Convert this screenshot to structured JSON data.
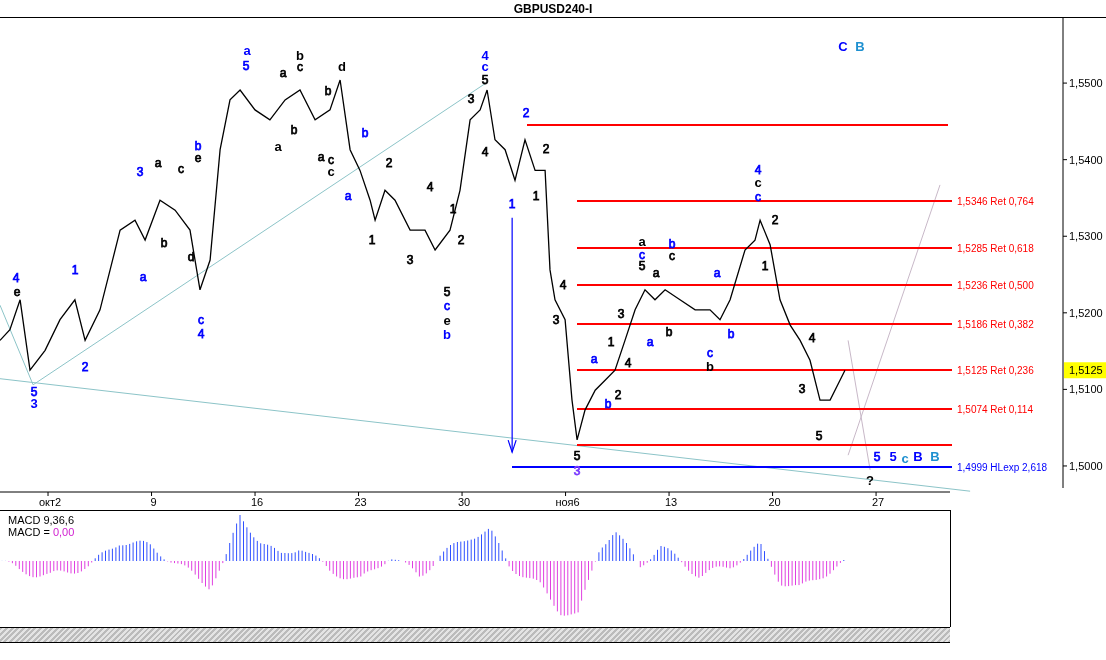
{
  "window": {
    "title": "GBPUSD240-I"
  },
  "main_chart": {
    "date_axis_labels": [
      "окт2",
      "9",
      "16",
      "23",
      "30",
      "ноя6",
      "13",
      "20",
      "27"
    ],
    "price_axis_labels": [
      "1,5500",
      "1,5400",
      "1,5300",
      "1,5200",
      "1,5100",
      "1,5000"
    ],
    "current_price": "1,5125",
    "levels": [
      {
        "color": "#ff0000"
      },
      {
        "color": "#ff0000",
        "label": "1,5346 Ret 0,764"
      },
      {
        "color": "#ff0000",
        "label": "1,5285 Ret 0,618"
      },
      {
        "color": "#ff0000",
        "label": "1,5236 Ret 0,500"
      },
      {
        "color": "#ff0000",
        "label": "1,5186 Ret 0,382"
      },
      {
        "color": "#ff0000",
        "label": "1,5125 Ret 0,236"
      },
      {
        "color": "#ff0000",
        "label": "1,5074 Ret 0,114"
      },
      {
        "color": "#ff0000"
      },
      {
        "color": "#0000ff",
        "label": "1,4999 HLexp 2,618"
      }
    ],
    "wave_labels": [
      {
        "text": "4",
        "color": "#0000ff",
        "bold": false
      },
      {
        "text": "e",
        "color": "#000000",
        "bold": false
      },
      {
        "text": "5",
        "color": "#0000ff",
        "bold": false
      },
      {
        "text": "3",
        "color": "#0000ff",
        "bold": true
      },
      {
        "text": "1",
        "color": "#0000ff",
        "bold": false
      },
      {
        "text": "2",
        "color": "#0000ff",
        "bold": false
      },
      {
        "text": "3",
        "color": "#0000ff",
        "bold": false
      },
      {
        "text": "a",
        "color": "#000000",
        "bold": false
      },
      {
        "text": "b",
        "color": "#000000",
        "bold": false
      },
      {
        "text": "c",
        "color": "#000000",
        "bold": false
      },
      {
        "text": "d",
        "color": "#000000",
        "bold": false
      },
      {
        "text": "b",
        "color": "#0000ff",
        "bold": false
      },
      {
        "text": "e",
        "color": "#000000",
        "bold": false
      },
      {
        "text": "a",
        "color": "#0000ff",
        "bold": false
      },
      {
        "text": "c",
        "color": "#0000ff",
        "bold": false
      },
      {
        "text": "4",
        "color": "#0000ff",
        "bold": false
      },
      {
        "text": "a",
        "color": "#0000ff",
        "bold": true
      },
      {
        "text": "5",
        "color": "#0000ff",
        "bold": false
      },
      {
        "text": "a",
        "color": "#000000",
        "bold": false
      },
      {
        "text": "b",
        "color": "#000000",
        "bold": true
      },
      {
        "text": "c",
        "color": "#000000",
        "bold": false
      },
      {
        "text": "a",
        "color": "#000000",
        "bold": true
      },
      {
        "text": "b",
        "color": "#000000",
        "bold": false
      },
      {
        "text": "d",
        "color": "#000000",
        "bold": true
      },
      {
        "text": "b",
        "color": "#000000",
        "bold": false
      },
      {
        "text": "a",
        "color": "#000000",
        "bold": false
      },
      {
        "text": "c",
        "color": "#000000",
        "bold": false
      },
      {
        "text": "c",
        "color": "#000000",
        "bold": true
      },
      {
        "text": "b",
        "color": "#0000ff",
        "bold": false
      },
      {
        "text": "a",
        "color": "#0000ff",
        "bold": false
      },
      {
        "text": "2",
        "color": "#000000",
        "bold": false
      },
      {
        "text": "1",
        "color": "#000000",
        "bold": false
      },
      {
        "text": "3",
        "color": "#000000",
        "bold": false
      },
      {
        "text": "4",
        "color": "#000000",
        "bold": false
      },
      {
        "text": "1",
        "color": "#000000",
        "bold": false
      },
      {
        "text": "2",
        "color": "#000000",
        "bold": false
      },
      {
        "text": "5",
        "color": "#000000",
        "bold": false
      },
      {
        "text": "c",
        "color": "#0000ff",
        "bold": false
      },
      {
        "text": "e",
        "color": "#000000",
        "bold": true
      },
      {
        "text": "b",
        "color": "#0000ff",
        "bold": true
      },
      {
        "text": "3",
        "color": "#000000",
        "bold": false
      },
      {
        "text": "4",
        "color": "#0000ff",
        "bold": true
      },
      {
        "text": "c",
        "color": "#0000ff",
        "bold": true
      },
      {
        "text": "5",
        "color": "#000000",
        "bold": false
      },
      {
        "text": "4",
        "color": "#000000",
        "bold": false
      },
      {
        "text": "2",
        "color": "#0000ff",
        "bold": false
      },
      {
        "text": "1",
        "color": "#0000ff",
        "bold": false
      },
      {
        "text": "2",
        "color": "#000000",
        "bold": false
      },
      {
        "text": "1",
        "color": "#000000",
        "bold": false
      },
      {
        "text": "4",
        "color": "#000000",
        "bold": false
      },
      {
        "text": "3",
        "color": "#000000",
        "bold": false
      },
      {
        "text": "5",
        "color": "#000000",
        "bold": false
      },
      {
        "text": "3",
        "color": "#7b3cff",
        "bold": false
      },
      {
        "text": "a",
        "color": "#0000ff",
        "bold": false
      },
      {
        "text": "b",
        "color": "#0000ff",
        "bold": false
      },
      {
        "text": "1",
        "color": "#000000",
        "bold": false
      },
      {
        "text": "2",
        "color": "#000000",
        "bold": false
      },
      {
        "text": "3",
        "color": "#000000",
        "bold": false
      },
      {
        "text": "4",
        "color": "#000000",
        "bold": false
      },
      {
        "text": "a",
        "color": "#000000",
        "bold": true
      },
      {
        "text": "c",
        "color": "#0000ff",
        "bold": false
      },
      {
        "text": "5",
        "color": "#000000",
        "bold": false
      },
      {
        "text": "a",
        "color": "#000000",
        "bold": false
      },
      {
        "text": "b",
        "color": "#0000ff",
        "bold": false
      },
      {
        "text": "c",
        "color": "#000000",
        "bold": false
      },
      {
        "text": "a",
        "color": "#0000ff",
        "bold": false
      },
      {
        "text": "b",
        "color": "#000000",
        "bold": false
      },
      {
        "text": "a",
        "color": "#0000ff",
        "bold": false
      },
      {
        "text": "b",
        "color": "#0000ff",
        "bold": false
      },
      {
        "text": "c",
        "color": "#0000ff",
        "bold": false
      },
      {
        "text": "b",
        "color": "#000000",
        "bold": true
      },
      {
        "text": "4",
        "color": "#0000ff",
        "bold": false
      },
      {
        "text": "c",
        "color": "#000000",
        "bold": true
      },
      {
        "text": "c",
        "color": "#0000ff",
        "bold": false
      },
      {
        "text": "2",
        "color": "#000000",
        "bold": false
      },
      {
        "text": "1",
        "color": "#000000",
        "bold": false
      },
      {
        "text": "4",
        "color": "#000000",
        "bold": false
      },
      {
        "text": "3",
        "color": "#000000",
        "bold": false
      },
      {
        "text": "5",
        "color": "#000000",
        "bold": false
      },
      {
        "text": "5",
        "color": "#0000ff",
        "bold": false
      },
      {
        "text": "5",
        "color": "#0000ff",
        "bold": true
      },
      {
        "text": "c",
        "color": "#1e90d0",
        "bold": true
      },
      {
        "text": "B",
        "color": "#0000ff",
        "bold": true
      },
      {
        "text": "B",
        "color": "#1e90d0",
        "bold": true
      },
      {
        "text": "?",
        "color": "#000000",
        "bold": true
      },
      {
        "text": "C",
        "color": "#0000ff",
        "bold": true
      },
      {
        "text": "B",
        "color": "#1e90d0",
        "bold": true
      }
    ]
  },
  "macd_panel": {
    "title": "MACD 9,36,6",
    "value_label": "MACD =",
    "value": "0,00"
  }
}
